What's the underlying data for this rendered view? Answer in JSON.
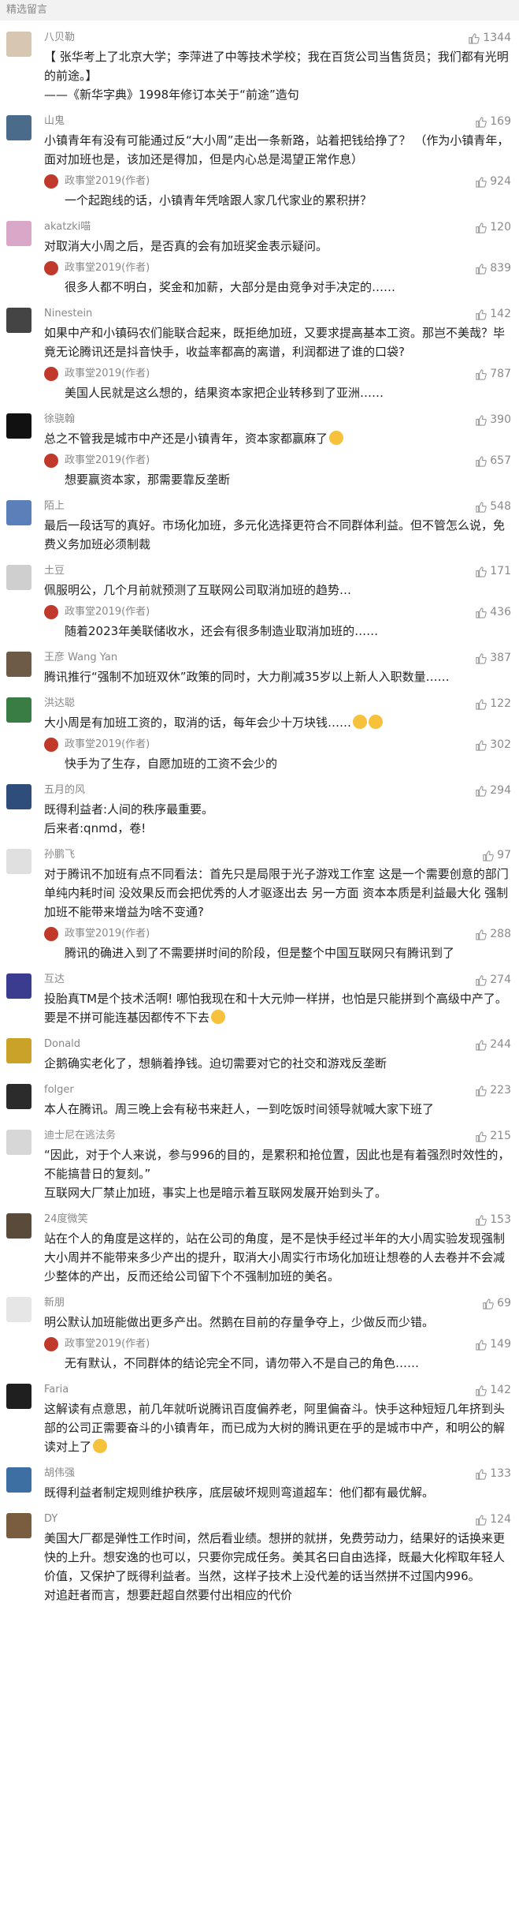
{
  "section_title": "精选留言",
  "colors": {
    "accent": "#c0392b",
    "meta": "#888888"
  },
  "comments": [
    {
      "user": "八贝勒",
      "likes": "1344",
      "avatar_color": "#d8c7b0",
      "lines": [
        "【 张华考上了北京大学；李萍进了中等技术学校；我在百货公司当售货员；我们都有光明的前途。】",
        "——《新华字典》1998年修订本关于“前途”造句"
      ],
      "replies": []
    },
    {
      "user": "山鬼",
      "likes": "169",
      "avatar_color": "#4a6b8a",
      "lines": [
        "小镇青年有没有可能通过反“大小周”走出一条新路，站着把钱给挣了？ （作为小镇青年，面对加班也是，该加还是得加，但是内心总是渴望正常作息）"
      ],
      "replies": [
        {
          "user": "政事堂2019(作者)",
          "likes": "924",
          "lines": [
            "一个起跑线的话，小镇青年凭啥跟人家几代家业的累积拼？"
          ]
        }
      ]
    },
    {
      "user": "akatzki喵",
      "likes": "120",
      "avatar_color": "#d9a7c7",
      "lines": [
        "对取消大小周之后，是否真的会有加班奖金表示疑问。"
      ],
      "replies": [
        {
          "user": "政事堂2019(作者)",
          "likes": "839",
          "lines": [
            "很多人都不明白，奖金和加薪，大部分是由竞争对手决定的……"
          ]
        }
      ]
    },
    {
      "user": "Ninestein",
      "likes": "142",
      "avatar_color": "#444444",
      "lines": [
        "如果中产和小镇码农们能联合起来，既拒绝加班，又要求提高基本工资。那岂不美哉？毕竟无论腾讯还是抖音快手，收益率都高的离谱，利润都进了谁的口袋?"
      ],
      "replies": [
        {
          "user": "政事堂2019(作者)",
          "likes": "787",
          "lines": [
            "美国人民就是这么想的，结果资本家把企业转移到了亚洲……"
          ]
        }
      ]
    },
    {
      "user": "徐骁翰",
      "likes": "390",
      "avatar_color": "#111111",
      "lines": [
        "总之不管我是城市中产还是小镇青年，资本家都赢麻了"
      ],
      "emoji_after": 1,
      "replies": [
        {
          "user": "政事堂2019(作者)",
          "likes": "657",
          "lines": [
            "想要赢资本家，那需要靠反垄断"
          ]
        }
      ]
    },
    {
      "user": "陌上",
      "likes": "548",
      "avatar_color": "#5b7fb8",
      "lines": [
        "最后一段话写的真好。市场化加班，多元化选择更符合不同群体利益。但不管怎么说，免费义务加班必须制裁"
      ],
      "replies": []
    },
    {
      "user": "土豆",
      "likes": "171",
      "avatar_color": "#cfcfcf",
      "lines": [
        "佩服明公，几个月前就预测了互联网公司取消加班的趋势…"
      ],
      "replies": [
        {
          "user": "政事堂2019(作者)",
          "likes": "436",
          "lines": [
            "随着2023年美联储收水，还会有很多制造业取消加班的……"
          ]
        }
      ]
    },
    {
      "user": "王彦 Wang Yan",
      "likes": "387",
      "avatar_color": "#6d5b46",
      "lines": [
        "腾讯推行“强制不加班双休”政策的同时，大力削减35岁以上新人入职数量……"
      ],
      "replies": []
    },
    {
      "user": "洪达聪",
      "likes": "122",
      "avatar_color": "#3a7d44",
      "lines": [
        "大小周是有加班工资的，取消的话，每年会少十万块钱……"
      ],
      "emoji_after": 2,
      "replies": [
        {
          "user": "政事堂2019(作者)",
          "likes": "302",
          "lines": [
            "快手为了生存，自愿加班的工资不会少的"
          ]
        }
      ]
    },
    {
      "user": "五月的风",
      "likes": "294",
      "avatar_color": "#2e4d7a",
      "lines": [
        "既得利益者:人间的秩序最重要。",
        "后来者:qnmd，卷!"
      ],
      "replies": []
    },
    {
      "user": "孙鹏飞",
      "likes": "97",
      "avatar_color": "#e0e0e0",
      "lines": [
        "对于腾讯不加班有点不同看法：首先只是局限于光子游戏工作室 这是一个需要创意的部门 单纯内耗时间 没效果反而会把优秀的人才驱逐出去 另一方面 资本本质是利益最大化 强制加班不能带来增益为啥不变通?"
      ],
      "replies": [
        {
          "user": "政事堂2019(作者)",
          "likes": "288",
          "lines": [
            "腾讯的确进入到了不需要拼时间的阶段，但是整个中国互联网只有腾讯到了"
          ]
        }
      ]
    },
    {
      "user": "互达",
      "likes": "274",
      "avatar_color": "#3b3b8f",
      "lines": [
        "投胎真TM是个技术活啊! 哪怕我现在和十大元帅一样拼，也怕是只能拼到个高级中产了。要是不拼可能连基因都传不下去"
      ],
      "emoji_after": 1,
      "replies": []
    },
    {
      "user": "Donald",
      "likes": "244",
      "avatar_color": "#c9a227",
      "lines": [
        "企鹅确实老化了，想躺着挣钱。迫切需要对它的社交和游戏反垄断"
      ],
      "replies": []
    },
    {
      "user": "folger",
      "likes": "223",
      "avatar_color": "#2b2b2b",
      "lines": [
        "本人在腾讯。周三晚上会有秘书来赶人，一到吃饭时间领导就喊大家下班了"
      ],
      "replies": []
    },
    {
      "user": "迪士尼在逃法务",
      "likes": "215",
      "avatar_color": "#d7d7d7",
      "lines": [
        "“因此，对于个人来说，参与996的目的，是累积和抢位置，因此也是有着强烈时效性的，不能搞昔日的复刻。”",
        " ",
        "互联网大厂禁止加班，事实上也是暗示着互联网发展开始到头了。"
      ],
      "replies": []
    },
    {
      "user": "24度微笑",
      "likes": "153",
      "avatar_color": "#5a4a3a",
      "lines": [
        "站在个人的角度是这样的，站在公司的角度，是不是快手经过半年的大小周实验发现强制大小周并不能带来多少产出的提升，取消大小周实行市场化加班让想卷的人去卷并不会减少整体的产出，反而还给公司留下个不强制加班的美名。"
      ],
      "replies": []
    },
    {
      "user": "新朋",
      "likes": "69",
      "avatar_color": "#e6e6e6",
      "lines": [
        "明公默认加班能做出更多产出。然鹅在目前的存量争夺上，少做反而少错。"
      ],
      "replies": [
        {
          "user": "政事堂2019(作者)",
          "likes": "149",
          "lines": [
            "无有默认，不同群体的结论完全不同，请勿带入不是自己的角色……"
          ]
        }
      ]
    },
    {
      "user": "Faria",
      "likes": "142",
      "avatar_color": "#1f1f1f",
      "lines": [
        "这解读有点意思，前几年就听说腾讯百度偏养老，阿里偏奋斗。快手这种短短几年挤到头部的公司正需要奋斗的小镇青年，而已成为大树的腾讯更在乎的是城市中产，和明公的解读对上了"
      ],
      "emoji_after": 1,
      "replies": []
    },
    {
      "user": "胡伟强",
      "likes": "133",
      "avatar_color": "#3d6fa3",
      "lines": [
        "既得利益者制定规则维护秩序，底层破坏规则弯道超车：他们都有最优解。"
      ],
      "replies": []
    },
    {
      "user": "DY",
      "likes": "124",
      "avatar_color": "#7a5c3e",
      "lines": [
        "美国大厂都是弹性工作时间，然后看业绩。想拼的就拼，免费劳动力，结果好的话换来更快的上升。想安逸的也可以，只要你完成任务。美其名曰自由选择，既最大化榨取年轻人价值，又保护了既得利益者。当然，这样子技术上没代差的话当然拼不过国内996。",
        "对追赶者而言，想要赶超自然要付出相应的代价"
      ],
      "replies": []
    }
  ]
}
